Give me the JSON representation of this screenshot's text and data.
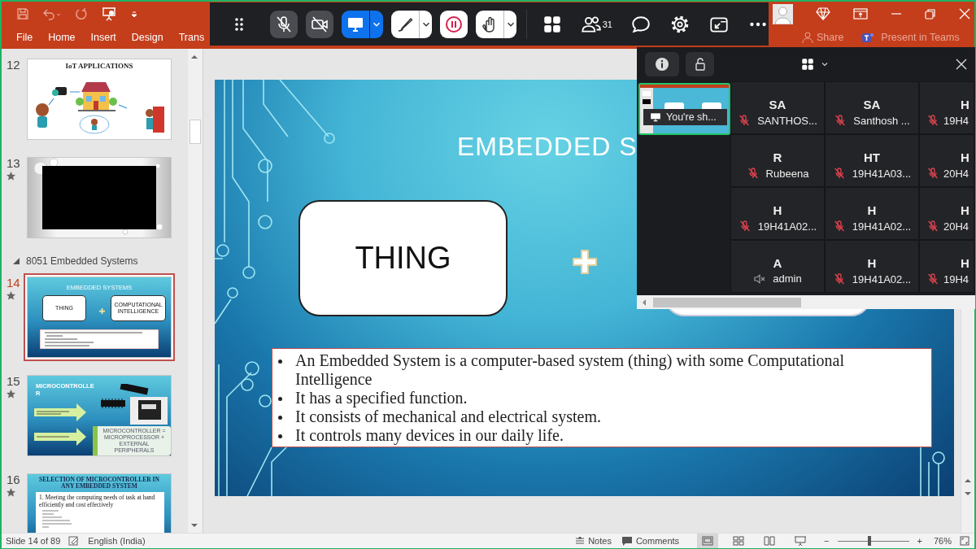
{
  "title_bar": {
    "ribbon_tabs": [
      {
        "label": "File"
      },
      {
        "label": "Home"
      },
      {
        "label": "Insert"
      },
      {
        "label": "Design"
      },
      {
        "label": "Trans"
      }
    ],
    "share": "Share",
    "present_in_teams": "Present in Teams"
  },
  "meeting_toolbar": {
    "mic_muted": true,
    "video_on": false,
    "sharing": true,
    "participants_count": "31"
  },
  "slide_pane": {
    "items": [
      {
        "kind": "iot",
        "number": "12",
        "selected": false,
        "animated": false,
        "title": "IoT APPLICATIONS"
      },
      {
        "kind": "video",
        "number": "13",
        "selected": false,
        "animated": true
      },
      {
        "kind": "section",
        "label": "8051 Embedded Systems",
        "expanded": true
      },
      {
        "kind": "embedded",
        "number": "14",
        "selected": true,
        "animated": true,
        "title": "EMBEDDED SYSTEMS",
        "box_1": "THING",
        "box_2": "COMPUTATIONAL INTELLIGENCE"
      },
      {
        "kind": "micro",
        "number": "15",
        "selected": false,
        "animated": true,
        "title": "MICROCONTROLLER",
        "note": "MICROCONTROLLER = MICROPROCESSOR + EXTERNAL PERIPHERALS"
      },
      {
        "kind": "selection",
        "number": "16",
        "selected": false,
        "animated": true,
        "title": "SELECTION OF MICROCONTROLLER IN ANY EMBEDDED SYSTEM",
        "body": "1. Meeting the computing needs of task at hand efficiently and cost effectively"
      }
    ]
  },
  "slide": {
    "title": "EMBEDDED S",
    "box_1": "THING",
    "bullets": [
      "An Embedded System is a computer-based system (thing) with some Computational Intelligence",
      "It has a specified function.",
      "It consists of mechanical and electrical system.",
      "It controls many devices in our daily life."
    ]
  },
  "participants_panel": {
    "self_view": {
      "label": "You're sh..."
    },
    "tiles": [
      {
        "initials": "SA",
        "name": "SANTHOS...",
        "kind": "mic",
        "muted": true
      },
      {
        "initials": "SA",
        "name": "Santhosh ...",
        "kind": "mic",
        "muted": true
      },
      {
        "initials": "H",
        "name": "19H4",
        "kind": "mic",
        "muted": true
      },
      {
        "initials": "R",
        "name": "Rubeena",
        "kind": "mic",
        "muted": true
      },
      {
        "initials": "HT",
        "name": "19H41A03...",
        "kind": "mic",
        "muted": true
      },
      {
        "initials": "H",
        "name": "20H4",
        "kind": "mic",
        "muted": true
      },
      {
        "initials": "H",
        "name": "19H41A02...",
        "kind": "mic",
        "muted": true
      },
      {
        "initials": "H",
        "name": "19H41A02...",
        "kind": "mic",
        "muted": true
      },
      {
        "initials": "H",
        "name": "20H4",
        "kind": "mic",
        "muted": true
      },
      {
        "initials": "A",
        "name": "admin",
        "kind": "speaker",
        "muted": true
      },
      {
        "initials": "H",
        "name": "19H41A02...",
        "kind": "mic",
        "muted": true
      },
      {
        "initials": "H",
        "name": "19H4",
        "kind": "mic",
        "muted": true
      }
    ]
  },
  "status_bar": {
    "slide_indicator": "Slide 14 of 89",
    "language": "English (India)",
    "notes": "Notes",
    "comments": "Comments",
    "views": [
      {
        "kind": "normal",
        "selected": true
      },
      {
        "kind": "sorter",
        "selected": false
      },
      {
        "kind": "reading",
        "selected": false
      },
      {
        "kind": "slideshow",
        "selected": false
      }
    ],
    "zoom_out": "−",
    "zoom_in": "+",
    "zoom": {
      "level": 0.45,
      "reading": "76%"
    }
  }
}
